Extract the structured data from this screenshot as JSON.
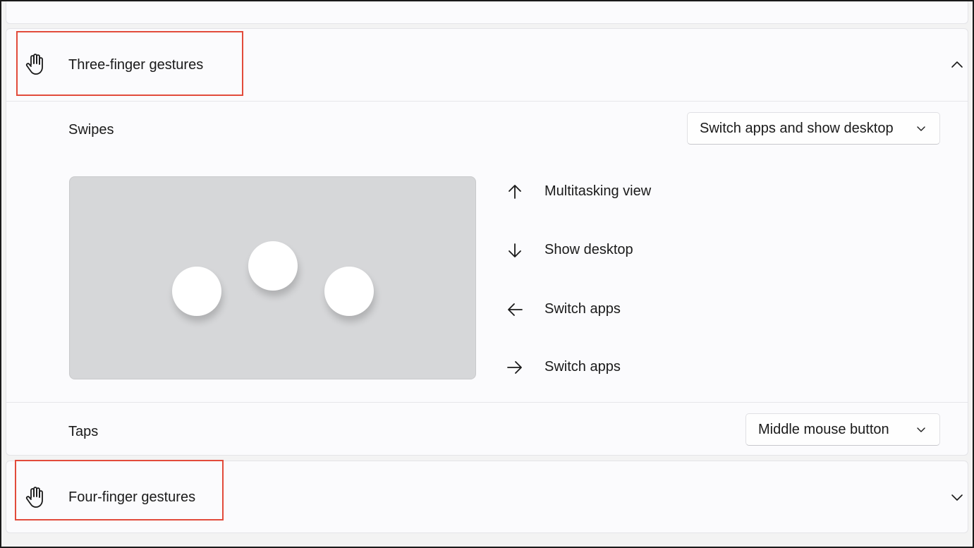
{
  "three_finger": {
    "title": "Three-finger gestures",
    "icon": "hand-icon",
    "expanded": true,
    "swipes": {
      "label": "Swipes",
      "selected": "Switch apps and show desktop"
    },
    "directions": [
      {
        "icon": "arrow-up-icon",
        "label": "Multitasking view"
      },
      {
        "icon": "arrow-down-icon",
        "label": "Show desktop"
      },
      {
        "icon": "arrow-left-icon",
        "label": "Switch apps"
      },
      {
        "icon": "arrow-right-icon",
        "label": "Switch apps"
      }
    ],
    "taps": {
      "label": "Taps",
      "selected": "Middle mouse button"
    }
  },
  "four_finger": {
    "title": "Four-finger gestures",
    "icon": "hand-icon",
    "expanded": false
  },
  "colors": {
    "highlight": "#e24b3b",
    "touchpad": "#d6d7d9",
    "card": "#fbfbfd"
  }
}
